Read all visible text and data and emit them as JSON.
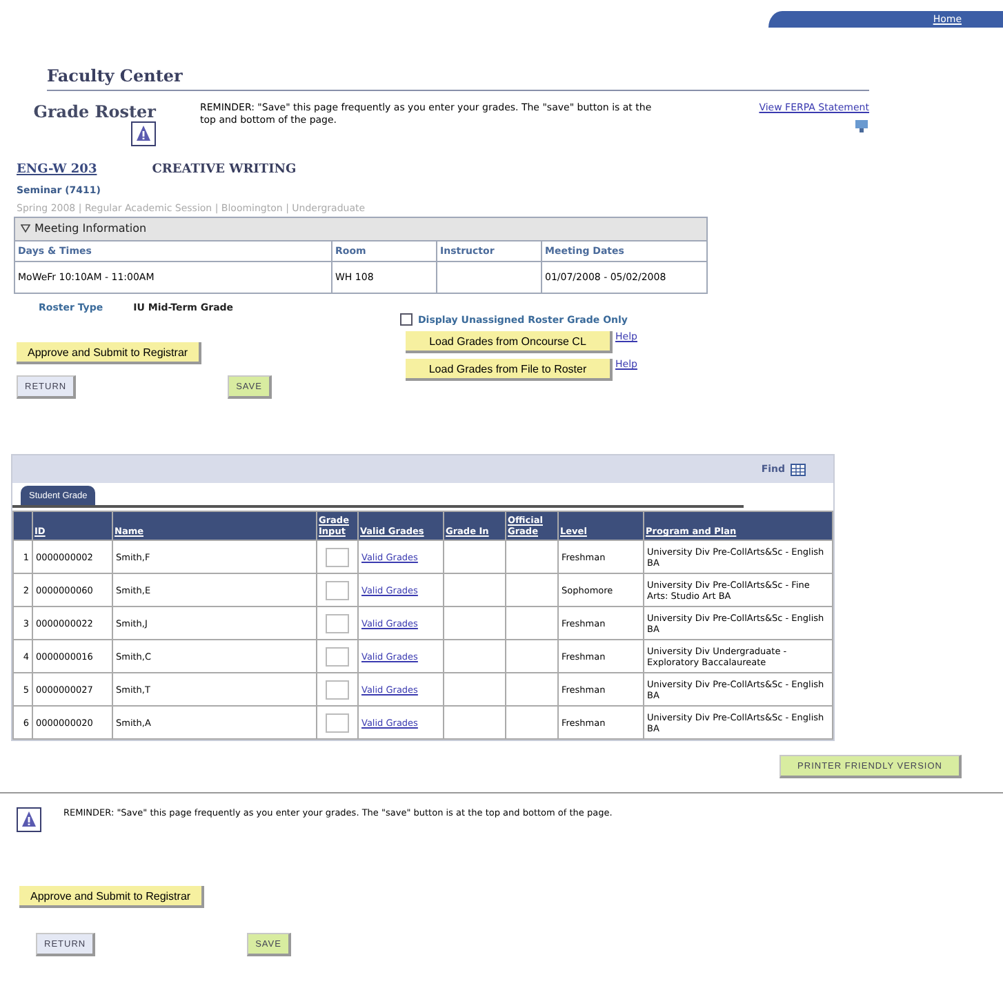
{
  "top_bar": {
    "home_link": "Home"
  },
  "page_title": "Faculty Center",
  "header": {
    "title": "Grade Roster",
    "reminder": "REMINDER:  \"Save\" this page frequently as you enter your grades.  The \"save\" button is at the top and bottom of the page.",
    "ferpa_link": "View FERPA Statement"
  },
  "course": {
    "code": "ENG-W 203",
    "title": "CREATIVE WRITING",
    "section": "Seminar  (7411)",
    "term": "Spring 2008 | Regular Academic Session | Bloomington | Undergraduate"
  },
  "meeting": {
    "title": "Meeting Information",
    "expanded": true,
    "columns": [
      "Days & Times",
      "Room",
      "Instructor",
      "Meeting Dates"
    ],
    "rows": [
      [
        "MoWeFr 10:10AM - 11:00AM",
        "WH 108",
        "",
        "01/07/2008 - 05/02/2008"
      ]
    ]
  },
  "roster_type": {
    "label": "Roster Type",
    "value": "IU Mid-Term Grade"
  },
  "unassigned_only": {
    "label": "Display Unassigned Roster Grade Only",
    "checked": false
  },
  "actions_top": {
    "approve": "Approve and Submit to Registrar",
    "return": "RETURN",
    "save": "SAVE"
  },
  "load_buttons": [
    {
      "label": "Load Grades from Oncourse CL",
      "help": "Help"
    },
    {
      "label": "Load Grades from File to Roster",
      "help": "Help"
    }
  ],
  "grid": {
    "find": "Find",
    "tabs": [
      {
        "label": "Student Grade",
        "selected": true
      }
    ],
    "columns": [
      "ID",
      "Name",
      "Grade Input",
      "Valid Grades",
      "Grade In",
      "Official Grade",
      "Level",
      "Program and Plan"
    ],
    "rows": [
      {
        "num": "1",
        "id": "0000000002",
        "name": "Smith,F",
        "valid": "Valid Grades",
        "level": "Freshman",
        "plan": "University Div Pre-CollArts&Sc - English BA"
      },
      {
        "num": "2",
        "id": "0000000060",
        "name": "Smith,E",
        "valid": "Valid Grades",
        "level": "Sophomore",
        "plan": "University Div Pre-CollArts&Sc - Fine Arts: Studio Art BA"
      },
      {
        "num": "3",
        "id": "0000000022",
        "name": "Smith,J",
        "valid": "Valid Grades",
        "level": "Freshman",
        "plan": "University Div Pre-CollArts&Sc - English BA"
      },
      {
        "num": "4",
        "id": "0000000016",
        "name": "Smith,C",
        "valid": "Valid Grades",
        "level": "Freshman",
        "plan": "University Div Undergraduate - Exploratory Baccalaureate"
      },
      {
        "num": "5",
        "id": "0000000027",
        "name": "Smith,T",
        "valid": "Valid Grades",
        "level": "Freshman",
        "plan": "University Div Pre-CollArts&Sc - English BA"
      },
      {
        "num": "6",
        "id": "0000000020",
        "name": "Smith,A",
        "valid": "Valid Grades",
        "level": "Freshman",
        "plan": "University Div Pre-CollArts&Sc - English BA"
      }
    ]
  },
  "printer_button": "PRINTER FRIENDLY VERSION",
  "bottom_reminder": "REMINDER:  \"Save\" this page frequently as you enter your grades.  The \"save\" button is at the top and bottom of the page.",
  "actions_bottom": {
    "approve": "Approve and Submit to Registrar",
    "return": "RETURN",
    "save": "SAVE"
  }
}
